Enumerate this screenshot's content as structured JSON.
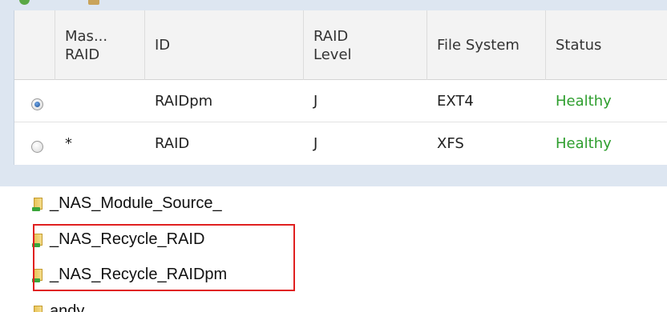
{
  "table": {
    "columns": {
      "master": "Mas...\nRAID",
      "id": "ID",
      "level": "RAID\nLevel",
      "filesystem": "File System",
      "status": "Status"
    },
    "rows": [
      {
        "selected": true,
        "master": "",
        "id": "RAIDpm",
        "level": "J",
        "filesystem": "EXT4",
        "status": "Healthy"
      },
      {
        "selected": false,
        "master": "*",
        "id": "RAID",
        "level": "J",
        "filesystem": "XFS",
        "status": "Healthy"
      }
    ],
    "status_color": "#2e9e2e"
  },
  "files": [
    {
      "name": "_NAS_Module_Source_",
      "icon": "shared-folder-icon"
    },
    {
      "name": "_NAS_Recycle_RAID",
      "icon": "shared-folder-icon"
    },
    {
      "name": "_NAS_Recycle_RAIDpm",
      "icon": "shared-folder-icon"
    },
    {
      "name": "andy",
      "icon": "folder-icon"
    }
  ],
  "highlight_color": "#e02020"
}
